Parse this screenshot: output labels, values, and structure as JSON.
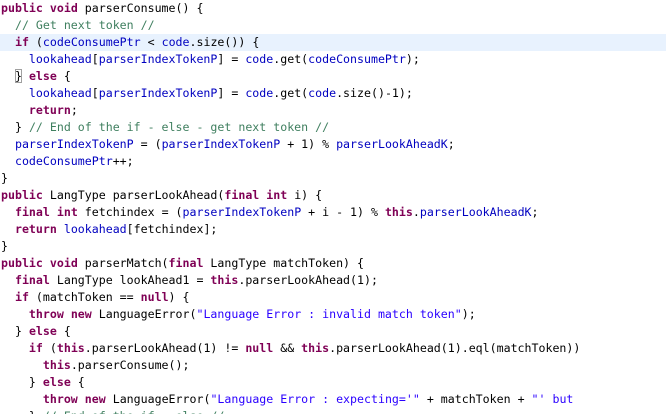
{
  "editor": {
    "current_line": 2,
    "lines": [
      {
        "indent": 0,
        "tokens": [
          {
            "t": "kw",
            "v": "public"
          },
          {
            "t": "pl",
            "v": " "
          },
          {
            "t": "kw",
            "v": "void"
          },
          {
            "t": "pl",
            "v": " parserConsume() {"
          }
        ]
      },
      {
        "indent": 1,
        "tokens": [
          {
            "t": "com",
            "v": "// Get next token //"
          }
        ]
      },
      {
        "indent": 1,
        "tokens": [
          {
            "t": "kw",
            "v": "if"
          },
          {
            "t": "pl",
            "v": " ("
          },
          {
            "t": "fld",
            "v": "codeConsumePtr"
          },
          {
            "t": "pl",
            "v": " < "
          },
          {
            "t": "fld",
            "v": "code"
          },
          {
            "t": "pl",
            "v": ".size()) {"
          }
        ]
      },
      {
        "indent": 2,
        "tokens": [
          {
            "t": "fld",
            "v": "lookahead"
          },
          {
            "t": "pl",
            "v": "["
          },
          {
            "t": "fld",
            "v": "parserIndexTokenP"
          },
          {
            "t": "pl",
            "v": "] = "
          },
          {
            "t": "fld",
            "v": "code"
          },
          {
            "t": "pl",
            "v": ".get("
          },
          {
            "t": "fld",
            "v": "codeConsumePtr"
          },
          {
            "t": "pl",
            "v": ");"
          }
        ]
      },
      {
        "indent": 1,
        "tokens": [
          {
            "t": "pl",
            "v": "}",
            "box": true
          },
          {
            "t": "pl",
            "v": " "
          },
          {
            "t": "kw",
            "v": "else"
          },
          {
            "t": "pl",
            "v": " {"
          }
        ]
      },
      {
        "indent": 2,
        "tokens": [
          {
            "t": "fld",
            "v": "lookahead"
          },
          {
            "t": "pl",
            "v": "["
          },
          {
            "t": "fld",
            "v": "parserIndexTokenP"
          },
          {
            "t": "pl",
            "v": "] = "
          },
          {
            "t": "fld",
            "v": "code"
          },
          {
            "t": "pl",
            "v": ".get("
          },
          {
            "t": "fld",
            "v": "code"
          },
          {
            "t": "pl",
            "v": ".size()-1);"
          }
        ]
      },
      {
        "indent": 2,
        "tokens": [
          {
            "t": "kw",
            "v": "return"
          },
          {
            "t": "pl",
            "v": ";"
          }
        ]
      },
      {
        "indent": 1,
        "tokens": [
          {
            "t": "pl",
            "v": "} "
          },
          {
            "t": "com",
            "v": "// End of the if - else - get next token //"
          }
        ]
      },
      {
        "indent": 1,
        "tokens": [
          {
            "t": "fld",
            "v": "parserIndexTokenP"
          },
          {
            "t": "pl",
            "v": " = ("
          },
          {
            "t": "fld",
            "v": "parserIndexTokenP"
          },
          {
            "t": "pl",
            "v": " + 1) % "
          },
          {
            "t": "fld",
            "v": "parserLookAheadK"
          },
          {
            "t": "pl",
            "v": ";"
          }
        ]
      },
      {
        "indent": 1,
        "tokens": [
          {
            "t": "fld",
            "v": "codeConsumePtr"
          },
          {
            "t": "pl",
            "v": "++;"
          }
        ]
      },
      {
        "indent": 0,
        "tokens": [
          {
            "t": "pl",
            "v": "}"
          }
        ]
      },
      {
        "indent": 0,
        "tokens": [
          {
            "t": "kw",
            "v": "public"
          },
          {
            "t": "pl",
            "v": " LangType parserLookAhead("
          },
          {
            "t": "kw",
            "v": "final"
          },
          {
            "t": "pl",
            "v": " "
          },
          {
            "t": "kw",
            "v": "int"
          },
          {
            "t": "pl",
            "v": " i) {"
          }
        ]
      },
      {
        "indent": 1,
        "tokens": [
          {
            "t": "kw",
            "v": "final"
          },
          {
            "t": "pl",
            "v": " "
          },
          {
            "t": "kw",
            "v": "int"
          },
          {
            "t": "pl",
            "v": " fetchindex = ("
          },
          {
            "t": "fld",
            "v": "parserIndexTokenP"
          },
          {
            "t": "pl",
            "v": " + i - 1) % "
          },
          {
            "t": "kw",
            "v": "this"
          },
          {
            "t": "pl",
            "v": "."
          },
          {
            "t": "fld",
            "v": "parserLookAheadK"
          },
          {
            "t": "pl",
            "v": ";"
          }
        ]
      },
      {
        "indent": 1,
        "tokens": [
          {
            "t": "kw",
            "v": "return"
          },
          {
            "t": "pl",
            "v": " "
          },
          {
            "t": "fld",
            "v": "lookahead"
          },
          {
            "t": "pl",
            "v": "[fetchindex];"
          }
        ]
      },
      {
        "indent": 0,
        "tokens": [
          {
            "t": "pl",
            "v": "}"
          }
        ]
      },
      {
        "indent": 0,
        "tokens": [
          {
            "t": "kw",
            "v": "public"
          },
          {
            "t": "pl",
            "v": " "
          },
          {
            "t": "kw",
            "v": "void"
          },
          {
            "t": "pl",
            "v": " parserMatch("
          },
          {
            "t": "kw",
            "v": "final"
          },
          {
            "t": "pl",
            "v": " LangType matchToken) {"
          }
        ]
      },
      {
        "indent": 1,
        "tokens": [
          {
            "t": "kw",
            "v": "final"
          },
          {
            "t": "pl",
            "v": " LangType lookAhead1 = "
          },
          {
            "t": "kw",
            "v": "this"
          },
          {
            "t": "pl",
            "v": ".parserLookAhead(1);"
          }
        ]
      },
      {
        "indent": 1,
        "tokens": [
          {
            "t": "kw",
            "v": "if"
          },
          {
            "t": "pl",
            "v": " (matchToken == "
          },
          {
            "t": "kw",
            "v": "null"
          },
          {
            "t": "pl",
            "v": ") {"
          }
        ]
      },
      {
        "indent": 2,
        "tokens": [
          {
            "t": "kw",
            "v": "throw"
          },
          {
            "t": "pl",
            "v": " "
          },
          {
            "t": "kw",
            "v": "new"
          },
          {
            "t": "pl",
            "v": " LanguageError("
          },
          {
            "t": "str",
            "v": "\"Language Error : invalid match token\""
          },
          {
            "t": "pl",
            "v": ");"
          }
        ]
      },
      {
        "indent": 1,
        "tokens": [
          {
            "t": "pl",
            "v": "} "
          },
          {
            "t": "kw",
            "v": "else"
          },
          {
            "t": "pl",
            "v": " {"
          }
        ]
      },
      {
        "indent": 2,
        "tokens": [
          {
            "t": "kw",
            "v": "if"
          },
          {
            "t": "pl",
            "v": " ("
          },
          {
            "t": "kw",
            "v": "this"
          },
          {
            "t": "pl",
            "v": ".parserLookAhead(1) != "
          },
          {
            "t": "kw",
            "v": "null"
          },
          {
            "t": "pl",
            "v": " && "
          },
          {
            "t": "kw",
            "v": "this"
          },
          {
            "t": "pl",
            "v": ".parserLookAhead(1).eql(matchToken))"
          }
        ]
      },
      {
        "indent": 3,
        "tokens": [
          {
            "t": "kw",
            "v": "this"
          },
          {
            "t": "pl",
            "v": ".parserConsume();"
          }
        ]
      },
      {
        "indent": 2,
        "tokens": [
          {
            "t": "pl",
            "v": "} "
          },
          {
            "t": "kw",
            "v": "else"
          },
          {
            "t": "pl",
            "v": " {"
          }
        ]
      },
      {
        "indent": 3,
        "tokens": [
          {
            "t": "kw",
            "v": "throw"
          },
          {
            "t": "pl",
            "v": " "
          },
          {
            "t": "kw",
            "v": "new"
          },
          {
            "t": "pl",
            "v": " LanguageError("
          },
          {
            "t": "str",
            "v": "\"Language Error : expecting='\""
          },
          {
            "t": "pl",
            "v": " + matchToken + "
          },
          {
            "t": "str",
            "v": "\"' but"
          }
        ]
      },
      {
        "indent": 2,
        "tokens": [
          {
            "t": "pl",
            "v": "} "
          },
          {
            "t": "com",
            "v": "// End of the if - else //"
          }
        ]
      }
    ]
  }
}
